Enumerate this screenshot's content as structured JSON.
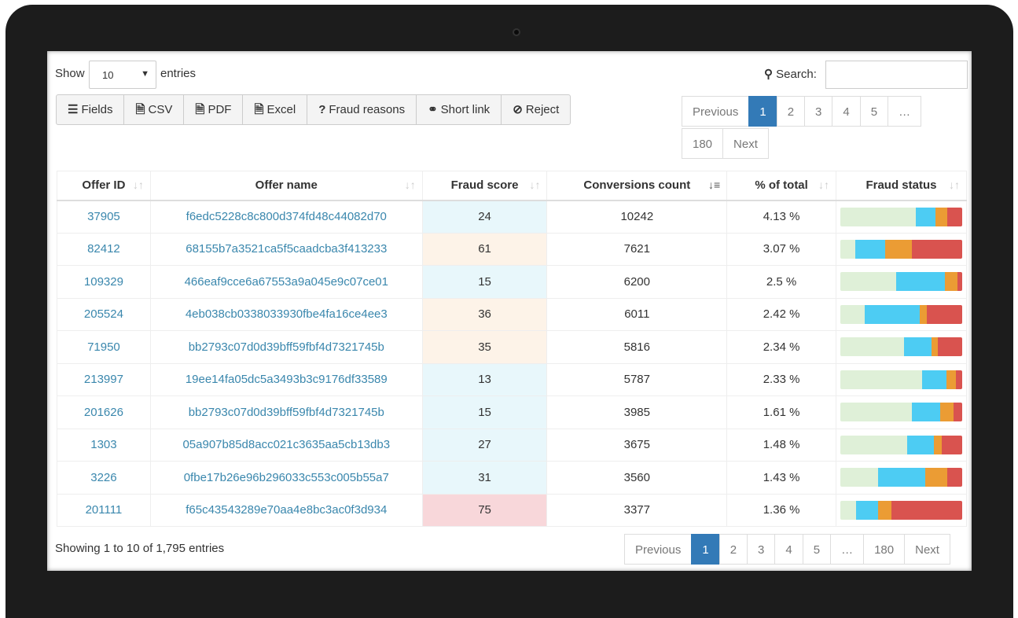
{
  "length": {
    "show": "Show",
    "value": "10",
    "entries": "entries"
  },
  "search": {
    "label": "Search:",
    "value": ""
  },
  "toolbar": [
    {
      "icon": "list-icon",
      "glyph": "☰",
      "label": "Fields"
    },
    {
      "icon": "csv-file-icon",
      "glyph": "🗎",
      "label": "CSV"
    },
    {
      "icon": "pdf-file-icon",
      "glyph": "🗎",
      "label": "PDF"
    },
    {
      "icon": "excel-file-icon",
      "glyph": "🗎",
      "label": "Excel"
    },
    {
      "icon": "question-icon",
      "glyph": "?",
      "label": "Fraud reasons"
    },
    {
      "icon": "link-icon",
      "glyph": "⚭",
      "label": "Short link"
    },
    {
      "icon": "ban-icon",
      "glyph": "⊘",
      "label": "Reject"
    }
  ],
  "pagination": {
    "previous": "Previous",
    "pages": [
      "1",
      "2",
      "3",
      "4",
      "5",
      "…",
      "180"
    ],
    "next": "Next",
    "active": "1"
  },
  "columns": [
    "Offer ID",
    "Offer name",
    "Fraud score",
    "Conversions count",
    "% of total",
    "Fraud status"
  ],
  "colors": {
    "clean": "#dff0d8",
    "low": "#4dccf3",
    "medium": "#eb9c34",
    "high": "#d9534f",
    "score_low": "#e8f7fb",
    "score_mid": "#fdf3e8",
    "score_high": "#f8d7da",
    "link": "#3a87ad",
    "active": "#337ab7"
  },
  "rows": [
    {
      "id": "37905",
      "name": "f6edc5228c8c800d374fd48c44082d70",
      "score": "24",
      "conv": "10242",
      "pct": "4.13 %",
      "level": "low",
      "status": [
        62,
        16,
        10,
        12
      ]
    },
    {
      "id": "82412",
      "name": "68155b7a3521ca5f5caadcba3f413233",
      "score": "61",
      "conv": "7621",
      "pct": "3.07 %",
      "level": "mid",
      "status": [
        12,
        25,
        22,
        41
      ]
    },
    {
      "id": "109329",
      "name": "466eaf9cce6a67553a9a045e9c07ce01",
      "score": "15",
      "conv": "6200",
      "pct": "2.5 %",
      "level": "low",
      "status": [
        46,
        40,
        10,
        4
      ]
    },
    {
      "id": "205524",
      "name": "4eb038cb0338033930fbe4fa16ce4ee3",
      "score": "36",
      "conv": "6011",
      "pct": "2.42 %",
      "level": "mid",
      "status": [
        20,
        45,
        6,
        29
      ]
    },
    {
      "id": "71950",
      "name": "bb2793c07d0d39bff59fbf4d7321745b",
      "score": "35",
      "conv": "5816",
      "pct": "2.34 %",
      "level": "mid",
      "status": [
        52,
        23,
        5,
        20
      ]
    },
    {
      "id": "213997",
      "name": "19ee14fa05dc5a3493b3c9176df33589",
      "score": "13",
      "conv": "5787",
      "pct": "2.33 %",
      "level": "low",
      "status": [
        67,
        20,
        8,
        5
      ]
    },
    {
      "id": "201626",
      "name": "bb2793c07d0d39bff59fbf4d7321745b",
      "score": "15",
      "conv": "3985",
      "pct": "1.61 %",
      "level": "low",
      "status": [
        59,
        23,
        11,
        7
      ]
    },
    {
      "id": "1303",
      "name": "05a907b85d8acc021c3635aa5cb13db3",
      "score": "27",
      "conv": "3675",
      "pct": "1.48 %",
      "level": "low",
      "status": [
        55,
        22,
        6,
        17
      ]
    },
    {
      "id": "3226",
      "name": "0fbe17b26e96b296033c553c005b55a7",
      "score": "31",
      "conv": "3560",
      "pct": "1.43 %",
      "level": "low",
      "status": [
        31,
        39,
        18,
        12
      ]
    },
    {
      "id": "201111",
      "name": "f65c43543289e70aa4e8bc3ac0f3d934",
      "score": "75",
      "conv": "3377",
      "pct": "1.36 %",
      "level": "high",
      "status": [
        13,
        18,
        11,
        58
      ]
    }
  ],
  "info": "Showing 1 to 10 of 1,795 entries"
}
